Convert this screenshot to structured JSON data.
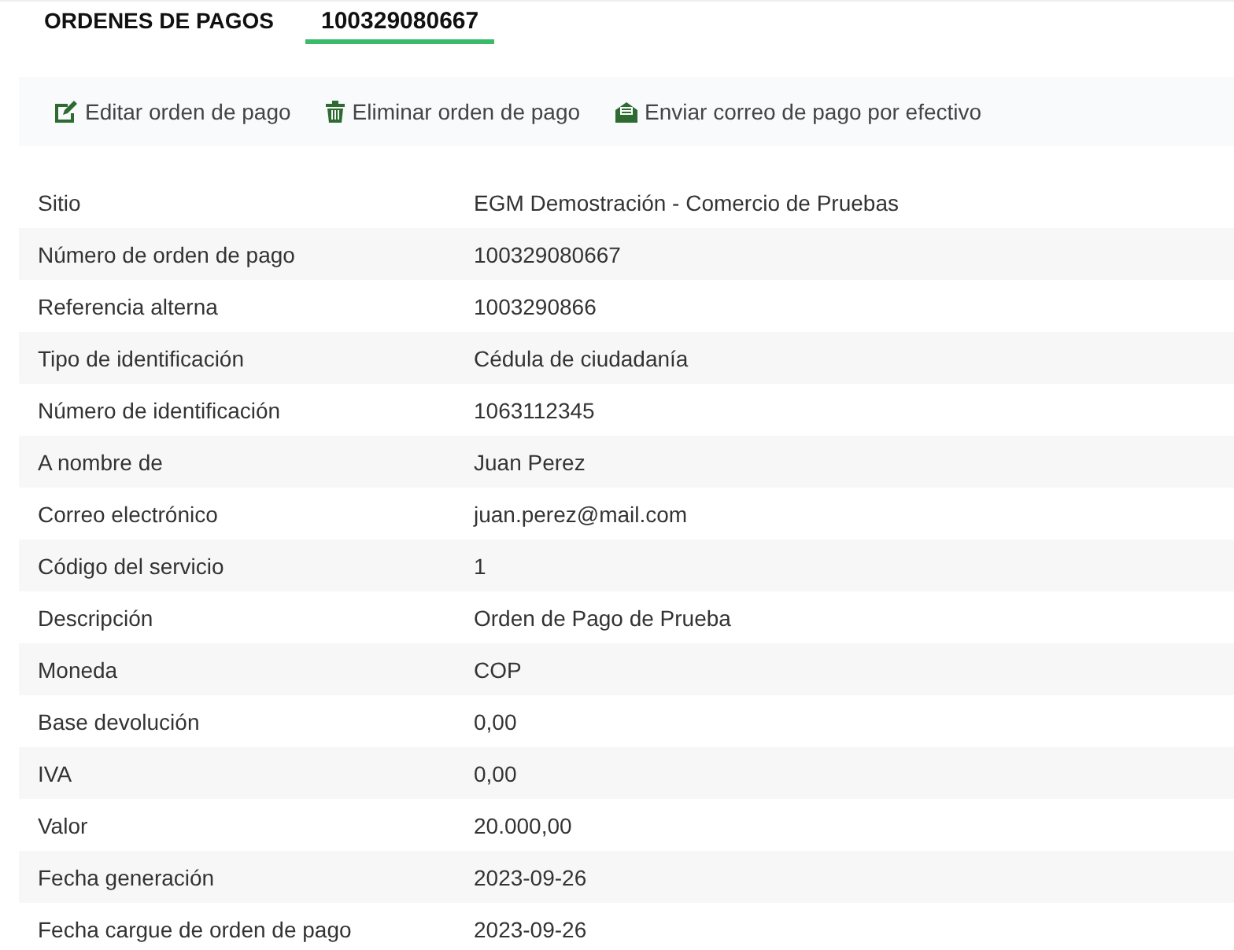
{
  "tabs": [
    {
      "label": "ORDENES DE PAGOS",
      "selected": false
    },
    {
      "label": "100329080667",
      "selected": true
    }
  ],
  "actions": [
    {
      "kind": "edit",
      "label": "Editar orden de pago"
    },
    {
      "kind": "delete",
      "label": "Eliminar orden de pago"
    },
    {
      "kind": "mail",
      "label": "Enviar correo de pago por efectivo"
    }
  ],
  "details": [
    {
      "label": "Sitio",
      "value": "EGM Demostración - Comercio de Pruebas"
    },
    {
      "label": "Número de orden de pago",
      "value": "100329080667"
    },
    {
      "label": "Referencia alterna",
      "value": "1003290866"
    },
    {
      "label": "Tipo de identificación",
      "value": "Cédula de ciudadanía"
    },
    {
      "label": "Número de identificación",
      "value": "1063112345"
    },
    {
      "label": "A nombre de",
      "value": "Juan Perez"
    },
    {
      "label": "Correo electrónico",
      "value": "juan.perez@mail.com"
    },
    {
      "label": "Código del servicio",
      "value": "1"
    },
    {
      "label": "Descripción",
      "value": "Orden de Pago de Prueba"
    },
    {
      "label": "Moneda",
      "value": "COP"
    },
    {
      "label": "Base devolución",
      "value": "0,00"
    },
    {
      "label": "IVA",
      "value": "0,00"
    },
    {
      "label": "Valor",
      "value": "20.000,00"
    },
    {
      "label": "Fecha generación",
      "value": "2023-09-26"
    },
    {
      "label": "Fecha cargue de orden de pago",
      "value": "2023-09-26"
    }
  ]
}
